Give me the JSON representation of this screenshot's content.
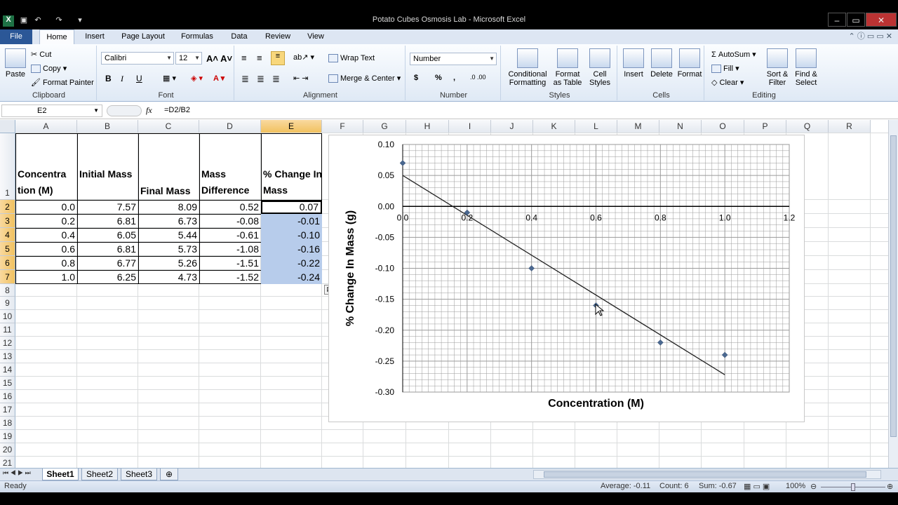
{
  "window": {
    "title": "Potato Cubes Osmosis Lab  -  Microsoft Excel"
  },
  "ribbon_tabs": [
    "File",
    "Home",
    "Insert",
    "Page Layout",
    "Formulas",
    "Data",
    "Review",
    "View"
  ],
  "clipboard": {
    "paste": "Paste",
    "cut": "Cut",
    "copy": "Copy",
    "format_painter": "Format Painter",
    "label": "Clipboard"
  },
  "font": {
    "name": "Calibri",
    "size": "12",
    "label": "Font",
    "bold": "B",
    "italic": "I",
    "underline": "U"
  },
  "alignment": {
    "wrap_text": "Wrap Text",
    "merge_center": "Merge & Center",
    "label": "Alignment"
  },
  "number": {
    "format": "Number",
    "currency": "$",
    "percent": "%",
    "comma": ",",
    "label": "Number"
  },
  "styles": {
    "conditional": "Conditional Formatting",
    "format_table": "Format as Table",
    "cell_styles": "Cell Styles",
    "label": "Styles"
  },
  "cells": {
    "insert": "Insert",
    "delete": "Delete",
    "format": "Format",
    "label": "Cells"
  },
  "editing": {
    "autosum": "AutoSum",
    "fill": "Fill",
    "clear": "Clear",
    "sort_filter": "Sort & Filter",
    "find_select": "Find & Select",
    "label": "Editing"
  },
  "formula_bar": {
    "name_box": "E2",
    "fx": "fx",
    "formula": "=D2/B2"
  },
  "columns": [
    "A",
    "B",
    "C",
    "D",
    "E",
    "F",
    "G",
    "H",
    "I",
    "J",
    "K",
    "L",
    "M",
    "N",
    "O",
    "P",
    "Q",
    "R"
  ],
  "rows": [
    "1",
    "2",
    "3",
    "4",
    "5",
    "6",
    "7",
    "8",
    "9",
    "10",
    "11",
    "12",
    "13",
    "14",
    "15",
    "16",
    "17",
    "18",
    "19",
    "20",
    "21"
  ],
  "headers": {
    "a": "Concentra tion (M)",
    "b": "Initial Mass",
    "c": "Final Mass",
    "d": "Mass Difference",
    "e": "% Change In Mass"
  },
  "table": [
    [
      "0.0",
      "7.57",
      "8.09",
      "0.52",
      "0.07"
    ],
    [
      "0.2",
      "6.81",
      "6.73",
      "-0.08",
      "-0.01"
    ],
    [
      "0.4",
      "6.05",
      "5.44",
      "-0.61",
      "-0.10"
    ],
    [
      "0.6",
      "6.81",
      "5.73",
      "-1.08",
      "-0.16"
    ],
    [
      "0.8",
      "6.77",
      "5.26",
      "-1.51",
      "-0.22"
    ],
    [
      "1.0",
      "6.25",
      "4.73",
      "-1.52",
      "-0.24"
    ]
  ],
  "chart_data": {
    "type": "scatter",
    "series": [
      {
        "x": [
          0.0,
          0.2,
          0.4,
          0.6,
          0.8,
          1.0
        ],
        "y": [
          0.07,
          -0.01,
          -0.1,
          -0.16,
          -0.22,
          -0.24
        ]
      }
    ],
    "trendline": {
      "x": [
        0.0,
        1.0
      ],
      "y": [
        0.05,
        -0.272
      ]
    },
    "xlabel": "Concentration  (M)",
    "ylabel": "% Change In Mass  (g)",
    "xlim": [
      0,
      1.2
    ],
    "ylim": [
      -0.3,
      0.1
    ],
    "xticks": [
      "0.0",
      "0.2",
      "0.4",
      "0.6",
      "0.8",
      "1.0",
      "1.2"
    ],
    "yticks": [
      "0.10",
      "0.05",
      "0.00",
      "-0.05",
      "-0.10",
      "-0.15",
      "-0.20",
      "-0.25",
      "-0.30"
    ],
    "grid": true
  },
  "sheets": [
    "Sheet1",
    "Sheet2",
    "Sheet3"
  ],
  "status": {
    "ready": "Ready",
    "average": "Average: -0.11",
    "count": "Count: 6",
    "sum": "Sum: -0.67",
    "zoom": "100%"
  }
}
